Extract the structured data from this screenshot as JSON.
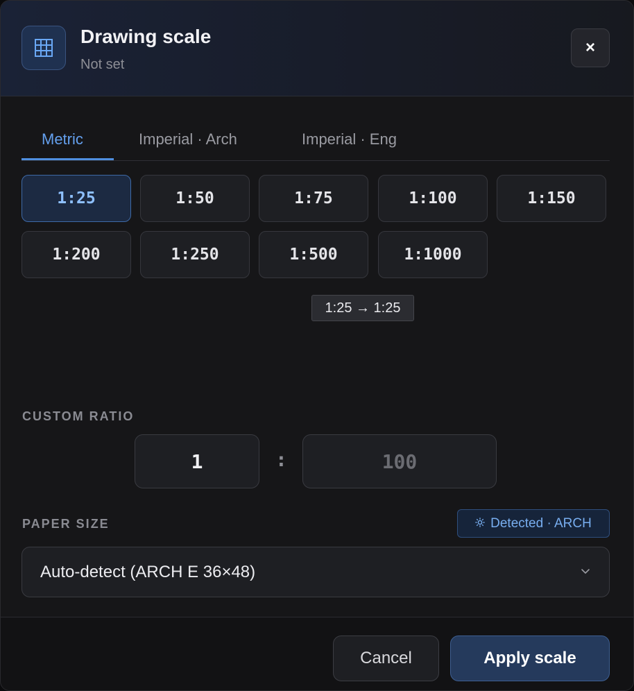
{
  "header": {
    "title": "Drawing scale",
    "subtitle": "Not set",
    "icon": "grid-icon",
    "close_label": "×"
  },
  "tabs": [
    {
      "label": "Metric",
      "active": true
    },
    {
      "label": "Imperial · Arch",
      "active": false
    },
    {
      "label": "Imperial · Eng",
      "active": false
    }
  ],
  "scales": [
    {
      "label": "1:25",
      "active": true
    },
    {
      "label": "1:50",
      "active": false
    },
    {
      "label": "1:75",
      "active": false
    },
    {
      "label": "1:100",
      "active": false
    },
    {
      "label": "1:150",
      "active": false
    },
    {
      "label": "1:200",
      "active": false
    },
    {
      "label": "1:250",
      "active": false
    },
    {
      "label": "1:500",
      "active": false
    },
    {
      "label": "1:1000",
      "active": false
    }
  ],
  "tooltip": "1:25 → 1:25",
  "custom_ratio": {
    "label": "CUSTOM RATIO",
    "left_value": "1",
    "separator": ":",
    "right_placeholder": "100"
  },
  "paper_size": {
    "label": "PAPER SIZE",
    "detected_badge": "Detected · ARCH",
    "detected_icon": "sun-icon",
    "selected": "Auto-detect (ARCH E 36×48)"
  },
  "footer": {
    "cancel_label": "Cancel",
    "apply_label": "Apply scale"
  },
  "colors": {
    "accent": "#4f8fe0",
    "active_text": "#64a0ee",
    "background": "#161618"
  }
}
